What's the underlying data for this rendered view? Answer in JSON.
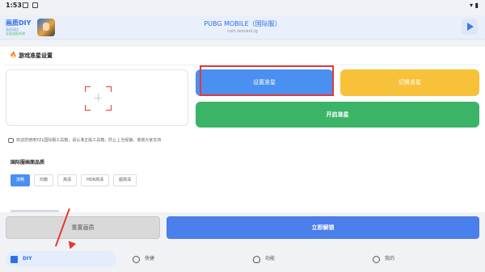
{
  "status_bar": {
    "time": "1:53"
  },
  "header": {
    "brand_title": "画质DIY",
    "brand_sub1": "画质调优",
    "brand_sub2": "全面适配系统",
    "game_title": "PUBG MOBILE（国际服）",
    "game_package": "com.tencent.ig"
  },
  "section": {
    "crosshair_title": "游戏准星设置",
    "set_crosshair": "设置准星",
    "switch_crosshair": "切换准星",
    "open_crosshair": "开启准星"
  },
  "notice": "欢迎您使用YZL国际服工具箱，请认准正版工具箱，防止上当受骗，谢谢大家支持",
  "quality": {
    "title": "国际服画面品质",
    "options": [
      "流畅",
      "均衡",
      "高清",
      "HDR高清",
      "超高清"
    ],
    "selected_index": 0
  },
  "actions": {
    "reset_label": "重置画质",
    "unlock_label": "立即解锁"
  },
  "tabs": [
    {
      "label": "DIY",
      "icon": "home-icon",
      "active": true
    },
    {
      "label": "快捷",
      "icon": "compass-icon",
      "active": false
    },
    {
      "label": "功能",
      "icon": "lightbulb-icon",
      "active": false
    },
    {
      "label": "我的",
      "icon": "user-face-icon",
      "active": false
    }
  ],
  "colors": {
    "primary": "#4a90f0",
    "yellow": "#f7c23a",
    "green": "#3cb468",
    "annotation_red": "#e53935"
  }
}
